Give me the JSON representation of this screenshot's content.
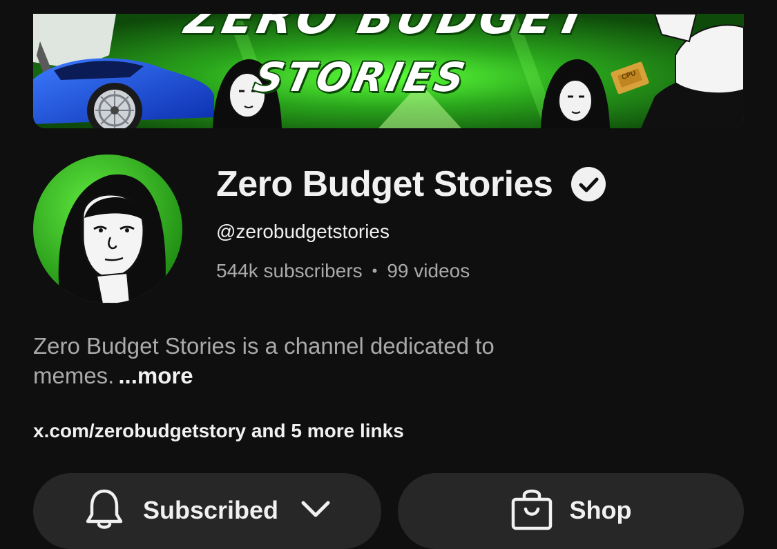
{
  "banner": {
    "title_top": "ZERO BUDGET",
    "title_bottom": "STORIES",
    "chip_label": "CPU"
  },
  "channel": {
    "name": "Zero Budget Stories",
    "handle": "@zerobudgetstories",
    "subscribers": "544k subscribers",
    "separator": "•",
    "videos": "99 videos",
    "verified": true
  },
  "description": {
    "text": "Zero Budget Stories is a channel dedicated to memes.",
    "more_label": "...more"
  },
  "links": {
    "text": "x.com/zerobudgetstory and 5 more links"
  },
  "actions": {
    "subscribe_label": "Subscribed",
    "shop_label": "Shop"
  },
  "icons": {
    "verified": "verified-check-icon",
    "bell": "bell-icon",
    "chevron": "chevron-down-icon",
    "shop": "shopping-bag-icon"
  },
  "colors": {
    "background": "#0f0f0f",
    "text_primary": "#f1f1f1",
    "text_secondary": "#aaaaaa",
    "button_bg": "#272727",
    "brand_green": "#3bd62a"
  }
}
